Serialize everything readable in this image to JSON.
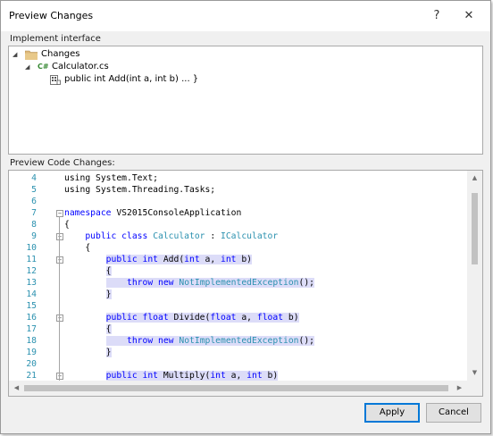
{
  "window": {
    "title": "Preview Changes",
    "help": "?",
    "close": "✕"
  },
  "section1": {
    "label": "Implement interface"
  },
  "tree": {
    "root": "Changes",
    "file": "Calculator.cs",
    "file_badge": "C#",
    "member": "public int Add(int a, int b) ... }"
  },
  "section2": {
    "label": "Preview Code Changes:"
  },
  "code": {
    "lines": [
      {
        "num": "4",
        "fold": "",
        "tokens": [
          [
            "",
            "using System.Text;"
          ]
        ]
      },
      {
        "num": "5",
        "fold": "",
        "tokens": [
          [
            "",
            "using System.Threading.Tasks;"
          ]
        ]
      },
      {
        "num": "6",
        "fold": "",
        "tokens": []
      },
      {
        "num": "7",
        "fold": "−",
        "tokens": [
          [
            "kw",
            "namespace"
          ],
          [
            "",
            " VS2015ConsoleApplication"
          ]
        ]
      },
      {
        "num": "8",
        "fold": "",
        "tokens": [
          [
            "",
            "{"
          ]
        ]
      },
      {
        "num": "9",
        "fold": "−",
        "tokens": [
          [
            "",
            "    "
          ],
          [
            "kw",
            "public class"
          ],
          [
            "",
            " "
          ],
          [
            "ty",
            "Calculator"
          ],
          [
            "",
            " : "
          ],
          [
            "ty",
            "ICalculator"
          ]
        ]
      },
      {
        "num": "10",
        "fold": "",
        "tokens": [
          [
            "",
            "    {"
          ]
        ]
      },
      {
        "num": "11",
        "fold": "−",
        "tokens": [
          [
            "",
            "        "
          ],
          [
            "kw hl",
            "public int"
          ],
          [
            "hl",
            " Add("
          ],
          [
            "kw hl",
            "int"
          ],
          [
            "hl",
            " a, "
          ],
          [
            "kw hl",
            "int"
          ],
          [
            "hl",
            " b)"
          ]
        ]
      },
      {
        "num": "12",
        "fold": "",
        "tokens": [
          [
            "",
            "        "
          ],
          [
            "hl",
            "{"
          ]
        ]
      },
      {
        "num": "13",
        "fold": "",
        "tokens": [
          [
            "",
            "        "
          ],
          [
            "hl",
            "    "
          ],
          [
            "kw hl",
            "throw new"
          ],
          [
            "hl",
            " "
          ],
          [
            "ty hl",
            "NotImplementedException"
          ],
          [
            "hl",
            "();"
          ]
        ]
      },
      {
        "num": "14",
        "fold": "",
        "tokens": [
          [
            "",
            "        "
          ],
          [
            "hl",
            "}"
          ]
        ]
      },
      {
        "num": "15",
        "fold": "",
        "tokens": []
      },
      {
        "num": "16",
        "fold": "−",
        "tokens": [
          [
            "",
            "        "
          ],
          [
            "kw hl",
            "public float"
          ],
          [
            "hl",
            " Divide("
          ],
          [
            "kw hl",
            "float"
          ],
          [
            "hl",
            " a, "
          ],
          [
            "kw hl",
            "float"
          ],
          [
            "hl",
            " b)"
          ]
        ]
      },
      {
        "num": "17",
        "fold": "",
        "tokens": [
          [
            "",
            "        "
          ],
          [
            "hl",
            "{"
          ]
        ]
      },
      {
        "num": "18",
        "fold": "",
        "tokens": [
          [
            "",
            "        "
          ],
          [
            "hl",
            "    "
          ],
          [
            "kw hl",
            "throw new"
          ],
          [
            "hl",
            " "
          ],
          [
            "ty hl",
            "NotImplementedException"
          ],
          [
            "hl",
            "();"
          ]
        ]
      },
      {
        "num": "19",
        "fold": "",
        "tokens": [
          [
            "",
            "        "
          ],
          [
            "hl",
            "}"
          ]
        ]
      },
      {
        "num": "20",
        "fold": "",
        "tokens": []
      },
      {
        "num": "21",
        "fold": "−",
        "tokens": [
          [
            "",
            "        "
          ],
          [
            "kw hl",
            "public int"
          ],
          [
            "hl",
            " Multiply("
          ],
          [
            "kw hl",
            "int"
          ],
          [
            "hl",
            " a, "
          ],
          [
            "kw hl",
            "int"
          ],
          [
            "hl",
            " b)"
          ]
        ]
      }
    ]
  },
  "buttons": {
    "apply": "Apply",
    "cancel": "Cancel"
  },
  "colors": {
    "keyword": "#0000ff",
    "type": "#2b91af",
    "added_highlight": "#dcdcf8",
    "line_number": "#2b91af"
  },
  "icons": {
    "root": "folder-icon",
    "file": "csharp-file-icon",
    "member": "method-icon"
  }
}
